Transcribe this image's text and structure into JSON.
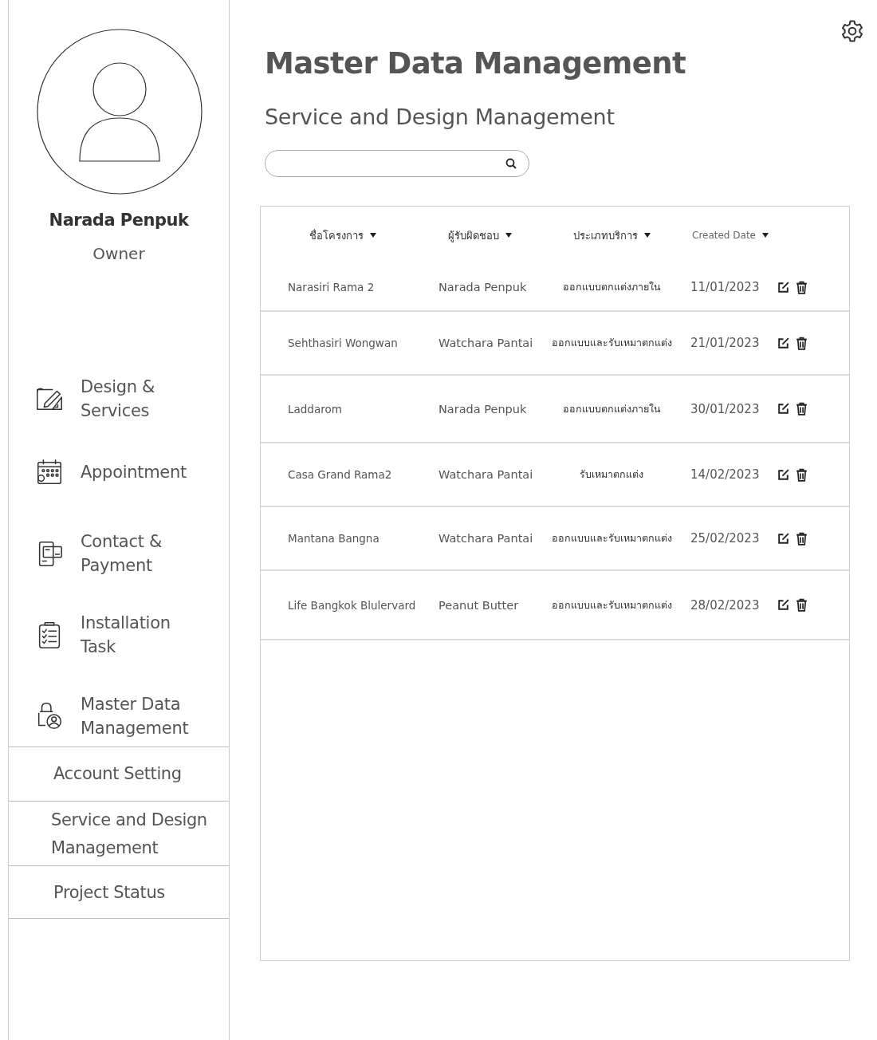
{
  "sidebar": {
    "user": {
      "name": "Narada Penpuk",
      "role": "Owner"
    },
    "items": [
      {
        "kind": "design",
        "label": "Design & Services"
      },
      {
        "kind": "calendar",
        "label": "Appointment"
      },
      {
        "kind": "payment",
        "label": "Contact & Payment"
      },
      {
        "kind": "task",
        "label": "Installation Task"
      },
      {
        "kind": "master",
        "label": "Master Data Management"
      }
    ],
    "sub_items": [
      "Account Setting",
      "Service and Design Management",
      "Project Status"
    ]
  },
  "page": {
    "title": "Master Data Management",
    "subtitle": "Service and Design Management"
  },
  "table": {
    "columns": [
      "ชื่อโครงการ",
      "ผู้รับผิดชอบ",
      "ประเภทบริการ",
      "Created Date"
    ],
    "rows": [
      [
        "Narasiri Rama 2",
        "Narada Penpuk",
        "ออกแบบตกแต่งภายใน",
        "11/01/2023"
      ],
      [
        "Sehthasiri Wongwan",
        "Watchara Pantai",
        "ออกแบบและรับเหมาตกแต่ง",
        "21/01/2023"
      ],
      [
        "Laddarom",
        "Narada Penpuk",
        "ออกแบบตกแต่งภายใน",
        "30/01/2023"
      ],
      [
        "Casa Grand Rama2",
        "Watchara Pantai",
        "รับเหมาตกแต่ง",
        "14/02/2023"
      ],
      [
        "Mantana Bangna",
        "Watchara Pantai",
        "ออกแบบและรับเหมาตกแต่ง",
        "25/02/2023"
      ],
      [
        "Life Bangkok Blulervard",
        "Peanut Butter",
        "ออกแบบและรับเหมาตกแต่ง",
        "28/02/2023"
      ]
    ]
  }
}
